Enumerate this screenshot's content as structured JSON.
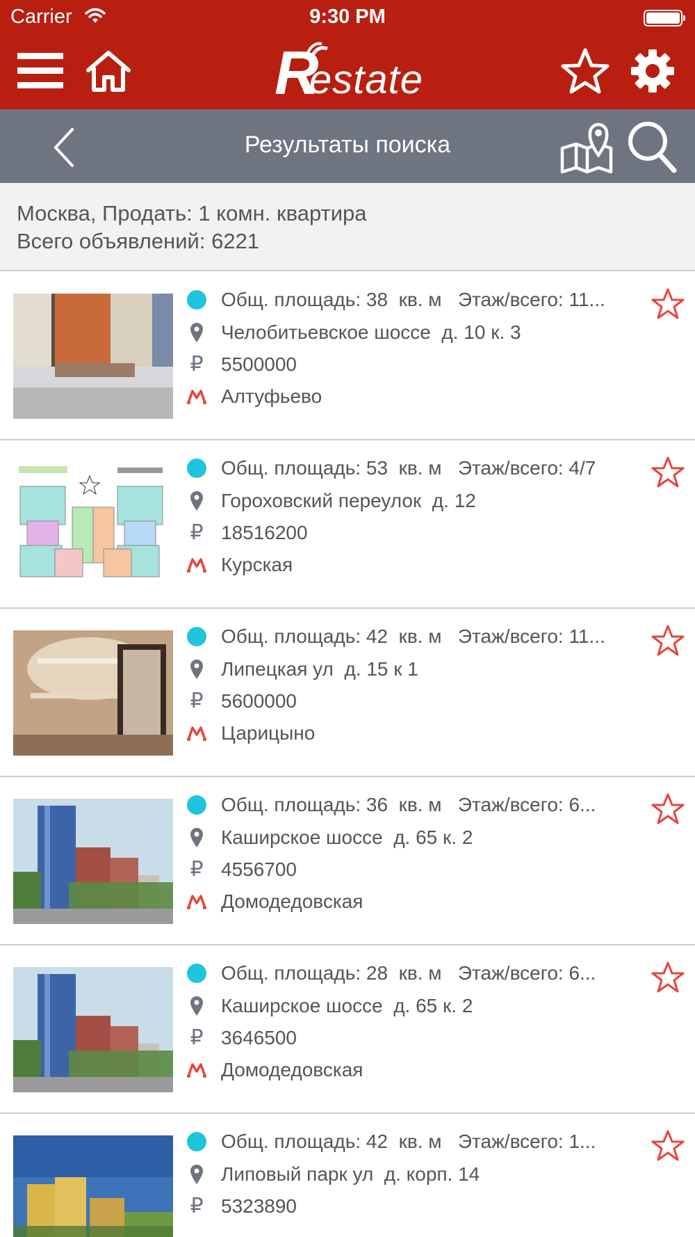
{
  "status_bar": {
    "carrier": "Carrier",
    "time": "9:30 PM"
  },
  "header": {
    "logo_r": "R",
    "logo_rest": "estate"
  },
  "nav": {
    "title": "Результаты поиска"
  },
  "summary": {
    "query": "Москва, Продать: 1 комн. квартира",
    "total": "Всего объявлений: 6221"
  },
  "colors": {
    "brand_red": "#b81f10",
    "nav_gray": "#6e7580",
    "dot_cyan": "#20c4dc",
    "metro_red": "#e8453c"
  },
  "listings": [
    {
      "info": "Общ. площадь: 38  кв. м   Этаж/всего: 11...",
      "address": "Челобитьевское шоссе  д. 10 к. 3",
      "price": "5500000",
      "metro": "Алтуфьево"
    },
    {
      "info": "Общ. площадь: 53  кв. м   Этаж/всего: 4/7",
      "address": "Гороховский переулок  д. 12",
      "price": "18516200",
      "metro": "Курская"
    },
    {
      "info": "Общ. площадь: 42  кв. м   Этаж/всего: 11...",
      "address": "Липецкая ул  д. 15 к 1",
      "price": "5600000",
      "metro": "Царицыно"
    },
    {
      "info": "Общ. площадь: 36  кв. м   Этаж/всего: 6...",
      "address": "Каширское шоссе  д. 65 к. 2",
      "price": "4556700",
      "metro": "Домодедовская"
    },
    {
      "info": "Общ. площадь: 28  кв. м   Этаж/всего: 6...",
      "address": "Каширское шоссе  д. 65 к. 2",
      "price": "3646500",
      "metro": "Домодедовская"
    },
    {
      "info": "Общ. площадь: 42  кв. м   Этаж/всего: 1...",
      "address": "Липовый парк ул  д. корп. 14",
      "price": "5323890",
      "metro": ""
    }
  ],
  "icons": {
    "currency": "₽",
    "names": [
      "menu-icon",
      "home-icon",
      "star-icon",
      "gear-icon",
      "back-chevron-icon",
      "map-pin-icon",
      "search-icon",
      "status-dot-icon",
      "location-pin-icon",
      "ruble-icon",
      "metro-icon",
      "favorite-star-icon"
    ]
  }
}
